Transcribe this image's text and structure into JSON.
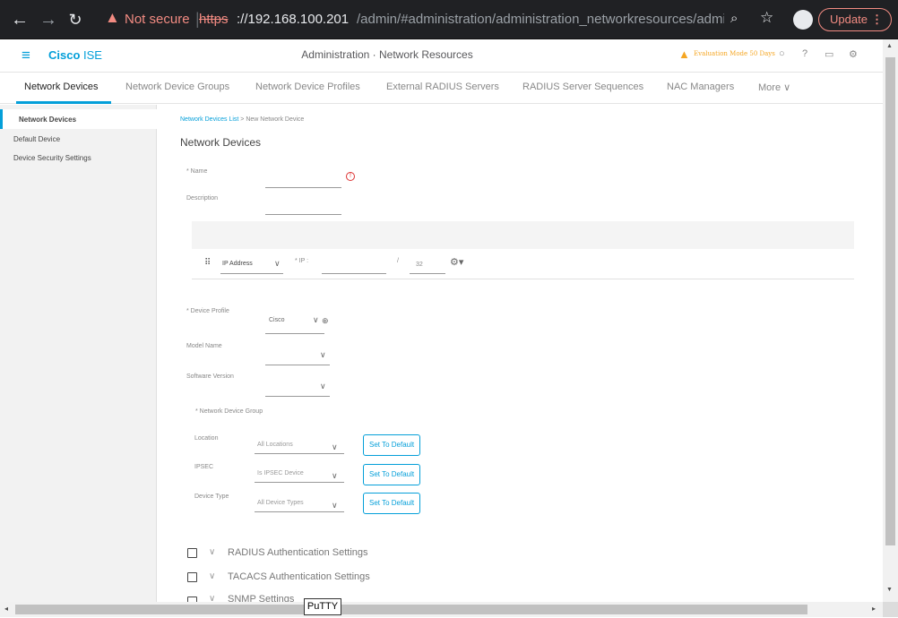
{
  "browser": {
    "back_icon": "arrow-left",
    "forward_icon": "arrow-right",
    "reload_icon": "reload",
    "security_label": "Not secure",
    "url_scheme": "https",
    "url_host": "://192.168.100.201",
    "url_path": "/admin/#administration/administration_networkresources/administrati...",
    "update_label": "Update",
    "update_color": "#f28b82"
  },
  "header": {
    "brand_bold": "Cisco",
    "brand_rest": " ISE",
    "title": "Administration · Network Resources",
    "evaluation": "Evaluation Mode 50 Days",
    "accent_color": "#049fd9",
    "warning_color": "#f5a623"
  },
  "tabs": [
    {
      "label": "Network Devices"
    },
    {
      "label": "Network Device Groups"
    },
    {
      "label": "Network Device Profiles"
    },
    {
      "label": "External RADIUS Servers"
    },
    {
      "label": "RADIUS Server Sequences"
    },
    {
      "label": "NAC Managers"
    },
    {
      "label": "More ∨"
    }
  ],
  "sidebar": {
    "items": [
      {
        "label": "Network Devices"
      },
      {
        "label": "Default Device"
      },
      {
        "label": "Device Security Settings"
      }
    ]
  },
  "main": {
    "breadcrumb_link": "Network Devices List",
    "breadcrumb_sep": " > ",
    "breadcrumb_current": "New Network Device",
    "title": "Network Devices",
    "name_label": "* Name",
    "description_label": "Description",
    "ip_type": "IP Address",
    "ip_label": "* IP :",
    "ip_slash": "/",
    "ip_mask": "32",
    "device_profile_label": "* Device Profile",
    "device_profile_value": "Cisco",
    "model_name_label": "Model Name",
    "software_version_label": "Software Version",
    "ndg_label": "* Network Device Group",
    "location_label": "Location",
    "location_value": "All Locations",
    "ipsec_label": "IPSEC",
    "ipsec_value": "Is IPSEC Device",
    "device_type_label": "Device Type",
    "device_type_value": "All Device Types",
    "set_default_label": "Set To Default",
    "sections": [
      {
        "label": "RADIUS Authentication Settings"
      },
      {
        "label": "TACACS Authentication Settings"
      },
      {
        "label": "SNMP Settings"
      }
    ]
  },
  "taskbar_tooltip": "PuTTY"
}
